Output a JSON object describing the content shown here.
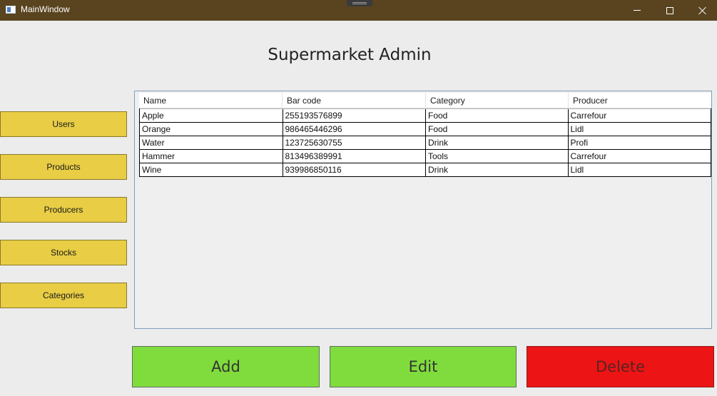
{
  "window": {
    "title": "MainWindow",
    "controls": [
      "minimize-icon",
      "maximize-icon",
      "close-icon"
    ],
    "titlebar_color": "#5a4420"
  },
  "page": {
    "title": "Supermarket Admin"
  },
  "sidebar": {
    "items": [
      {
        "label": "Users"
      },
      {
        "label": "Products"
      },
      {
        "label": "Producers"
      },
      {
        "label": "Stocks"
      },
      {
        "label": "Categories"
      }
    ],
    "button_color": "#e8cd45"
  },
  "table": {
    "columns": [
      "Name",
      "Bar code",
      "Category",
      "Producer"
    ],
    "rows": [
      [
        "Apple",
        "255193576899",
        "Food",
        "Carrefour"
      ],
      [
        "Orange",
        "986465446296",
        "Food",
        "Lidl"
      ],
      [
        "Water",
        "123725630755",
        "Drink",
        "Profi"
      ],
      [
        "Hammer",
        "813496389991",
        "Tools",
        "Carrefour"
      ],
      [
        "Wine",
        "939986850116",
        "Drink",
        "Lidl"
      ]
    ]
  },
  "actions": {
    "add_label": "Add",
    "edit_label": "Edit",
    "delete_label": "Delete",
    "add_color": "#80dc3c",
    "edit_color": "#80dc3c",
    "delete_color": "#ec1414"
  }
}
